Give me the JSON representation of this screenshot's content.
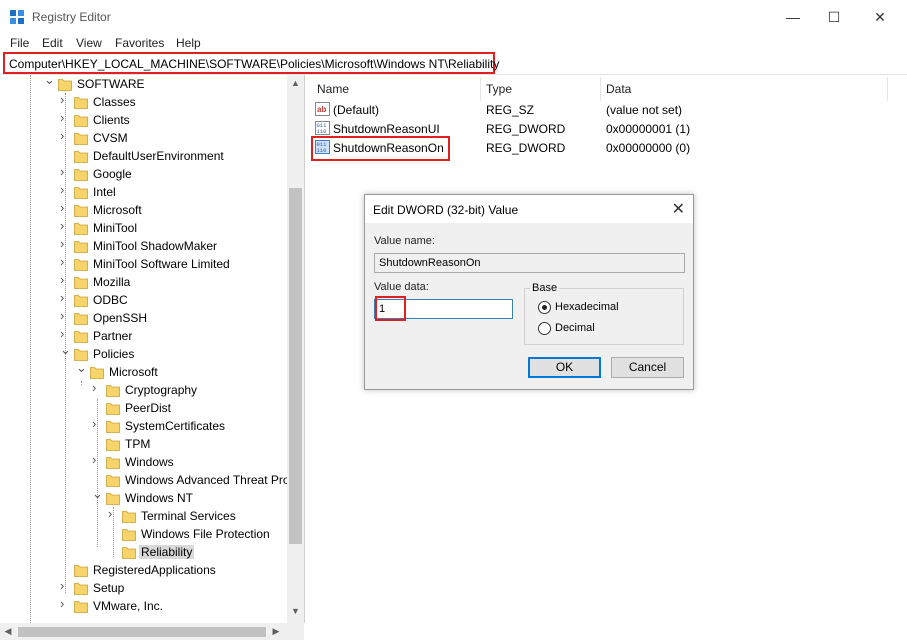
{
  "window": {
    "title": "Registry Editor",
    "minimize_glyph": "—",
    "maximize_glyph": "☐",
    "close_glyph": "✕"
  },
  "menu": [
    "File",
    "Edit",
    "View",
    "Favorites",
    "Help"
  ],
  "address": "Computer\\HKEY_LOCAL_MACHINE\\SOFTWARE\\Policies\\Microsoft\\Windows NT\\Reliability",
  "tree": [
    {
      "label": "SOFTWARE",
      "depth": 0,
      "state": "expanded"
    },
    {
      "label": "Classes",
      "depth": 1,
      "state": "collapsed"
    },
    {
      "label": "Clients",
      "depth": 1,
      "state": "collapsed"
    },
    {
      "label": "CVSM",
      "depth": 1,
      "state": "collapsed"
    },
    {
      "label": "DefaultUserEnvironment",
      "depth": 1,
      "state": "leaf"
    },
    {
      "label": "Google",
      "depth": 1,
      "state": "collapsed"
    },
    {
      "label": "Intel",
      "depth": 1,
      "state": "collapsed"
    },
    {
      "label": "Microsoft",
      "depth": 1,
      "state": "collapsed"
    },
    {
      "label": "MiniTool",
      "depth": 1,
      "state": "collapsed"
    },
    {
      "label": "MiniTool ShadowMaker",
      "depth": 1,
      "state": "collapsed"
    },
    {
      "label": "MiniTool Software Limited",
      "depth": 1,
      "state": "collapsed"
    },
    {
      "label": "Mozilla",
      "depth": 1,
      "state": "collapsed"
    },
    {
      "label": "ODBC",
      "depth": 1,
      "state": "collapsed"
    },
    {
      "label": "OpenSSH",
      "depth": 1,
      "state": "collapsed"
    },
    {
      "label": "Partner",
      "depth": 1,
      "state": "collapsed"
    },
    {
      "label": "Policies",
      "depth": 1,
      "state": "expanded"
    },
    {
      "label": "Microsoft",
      "depth": 2,
      "state": "expanded"
    },
    {
      "label": "Cryptography",
      "depth": 3,
      "state": "collapsed"
    },
    {
      "label": "PeerDist",
      "depth": 3,
      "state": "leaf"
    },
    {
      "label": "SystemCertificates",
      "depth": 3,
      "state": "collapsed"
    },
    {
      "label": "TPM",
      "depth": 3,
      "state": "leaf"
    },
    {
      "label": "Windows",
      "depth": 3,
      "state": "collapsed"
    },
    {
      "label": "Windows Advanced Threat Pro",
      "depth": 3,
      "state": "leaf"
    },
    {
      "label": "Windows NT",
      "depth": 3,
      "state": "expanded"
    },
    {
      "label": "Terminal Services",
      "depth": 4,
      "state": "collapsed"
    },
    {
      "label": "Windows File Protection",
      "depth": 4,
      "state": "leaf"
    },
    {
      "label": "Reliability",
      "depth": 4,
      "state": "leaf",
      "selected": true
    },
    {
      "label": "RegisteredApplications",
      "depth": 1,
      "state": "leaf"
    },
    {
      "label": "Setup",
      "depth": 1,
      "state": "collapsed"
    },
    {
      "label": "VMware, Inc.",
      "depth": 1,
      "state": "collapsed"
    }
  ],
  "list": {
    "headers": {
      "name": "Name",
      "type": "Type",
      "data": "Data"
    },
    "rows": [
      {
        "name": "(Default)",
        "type": "REG_SZ",
        "data": "(value not set)",
        "icon": "string-value-icon"
      },
      {
        "name": "ShutdownReasonUI",
        "type": "REG_DWORD",
        "data": "0x00000001 (1)",
        "icon": "binary-value-icon"
      },
      {
        "name": "ShutdownReasonOn",
        "type": "REG_DWORD",
        "data": "0x00000000 (0)",
        "icon": "binary-value-icon"
      }
    ]
  },
  "dialog": {
    "title": "Edit DWORD (32-bit) Value",
    "value_name_label": "Value name:",
    "value_name": "ShutdownReasonOn",
    "value_data_label": "Value data:",
    "value_data": "1",
    "base_label": "Base",
    "radio_hex": "Hexadecimal",
    "radio_dec": "Decimal",
    "base_selected": "Hexadecimal",
    "ok": "OK",
    "cancel": "Cancel"
  },
  "colors": {
    "highlight": "#e02020",
    "folder": "#f6d36b",
    "selection": "#d9d9d9",
    "focus_border": "#0078d7"
  }
}
